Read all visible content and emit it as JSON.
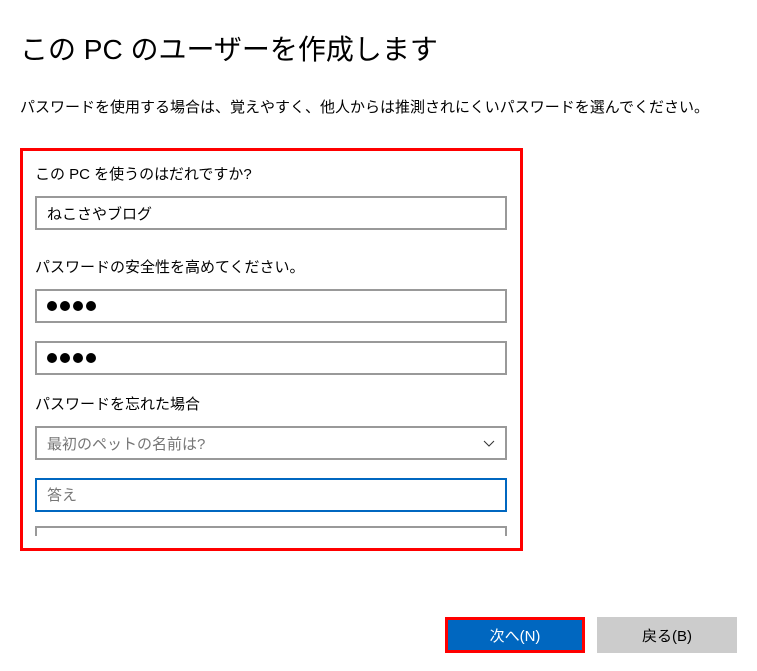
{
  "header": {
    "title": "この PC のユーザーを作成します",
    "description": "パスワードを使用する場合は、覚えやすく、他人からは推測されにくいパスワードを選んでください。"
  },
  "form": {
    "username_label": "この PC を使うのはだれですか?",
    "username_value": "ねこさやブログ",
    "password_label": "パスワードの安全性を高めてください。",
    "password_dots": 4,
    "confirm_dots": 4,
    "recovery_label": "パスワードを忘れた場合",
    "security_question": "最初のペットの名前は?",
    "answer_placeholder": "答え"
  },
  "buttons": {
    "next": "次へ(N)",
    "back": "戻る(B)"
  }
}
